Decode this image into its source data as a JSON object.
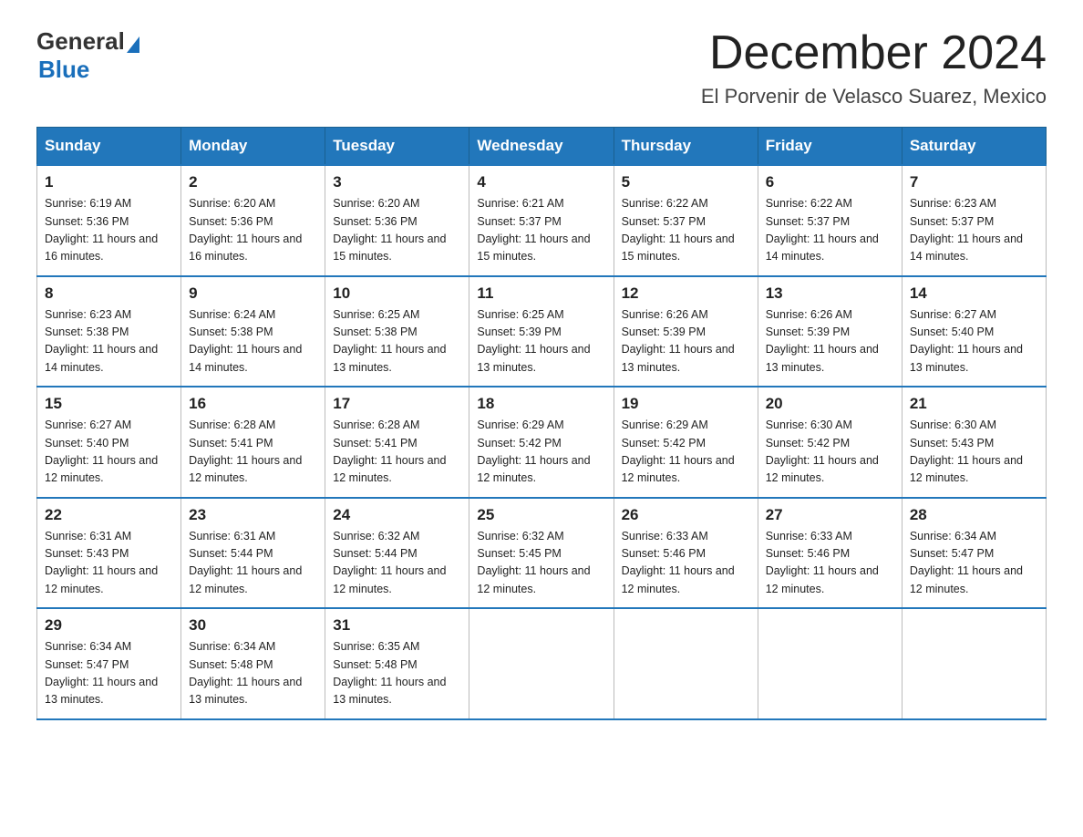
{
  "logo": {
    "general": "General",
    "blue": "Blue"
  },
  "header": {
    "title": "December 2024",
    "subtitle": "El Porvenir de Velasco Suarez, Mexico"
  },
  "days_of_week": [
    "Sunday",
    "Monday",
    "Tuesday",
    "Wednesday",
    "Thursday",
    "Friday",
    "Saturday"
  ],
  "weeks": [
    [
      {
        "day": "1",
        "sunrise": "Sunrise: 6:19 AM",
        "sunset": "Sunset: 5:36 PM",
        "daylight": "Daylight: 11 hours and 16 minutes."
      },
      {
        "day": "2",
        "sunrise": "Sunrise: 6:20 AM",
        "sunset": "Sunset: 5:36 PM",
        "daylight": "Daylight: 11 hours and 16 minutes."
      },
      {
        "day": "3",
        "sunrise": "Sunrise: 6:20 AM",
        "sunset": "Sunset: 5:36 PM",
        "daylight": "Daylight: 11 hours and 15 minutes."
      },
      {
        "day": "4",
        "sunrise": "Sunrise: 6:21 AM",
        "sunset": "Sunset: 5:37 PM",
        "daylight": "Daylight: 11 hours and 15 minutes."
      },
      {
        "day": "5",
        "sunrise": "Sunrise: 6:22 AM",
        "sunset": "Sunset: 5:37 PM",
        "daylight": "Daylight: 11 hours and 15 minutes."
      },
      {
        "day": "6",
        "sunrise": "Sunrise: 6:22 AM",
        "sunset": "Sunset: 5:37 PM",
        "daylight": "Daylight: 11 hours and 14 minutes."
      },
      {
        "day": "7",
        "sunrise": "Sunrise: 6:23 AM",
        "sunset": "Sunset: 5:37 PM",
        "daylight": "Daylight: 11 hours and 14 minutes."
      }
    ],
    [
      {
        "day": "8",
        "sunrise": "Sunrise: 6:23 AM",
        "sunset": "Sunset: 5:38 PM",
        "daylight": "Daylight: 11 hours and 14 minutes."
      },
      {
        "day": "9",
        "sunrise": "Sunrise: 6:24 AM",
        "sunset": "Sunset: 5:38 PM",
        "daylight": "Daylight: 11 hours and 14 minutes."
      },
      {
        "day": "10",
        "sunrise": "Sunrise: 6:25 AM",
        "sunset": "Sunset: 5:38 PM",
        "daylight": "Daylight: 11 hours and 13 minutes."
      },
      {
        "day": "11",
        "sunrise": "Sunrise: 6:25 AM",
        "sunset": "Sunset: 5:39 PM",
        "daylight": "Daylight: 11 hours and 13 minutes."
      },
      {
        "day": "12",
        "sunrise": "Sunrise: 6:26 AM",
        "sunset": "Sunset: 5:39 PM",
        "daylight": "Daylight: 11 hours and 13 minutes."
      },
      {
        "day": "13",
        "sunrise": "Sunrise: 6:26 AM",
        "sunset": "Sunset: 5:39 PM",
        "daylight": "Daylight: 11 hours and 13 minutes."
      },
      {
        "day": "14",
        "sunrise": "Sunrise: 6:27 AM",
        "sunset": "Sunset: 5:40 PM",
        "daylight": "Daylight: 11 hours and 13 minutes."
      }
    ],
    [
      {
        "day": "15",
        "sunrise": "Sunrise: 6:27 AM",
        "sunset": "Sunset: 5:40 PM",
        "daylight": "Daylight: 11 hours and 12 minutes."
      },
      {
        "day": "16",
        "sunrise": "Sunrise: 6:28 AM",
        "sunset": "Sunset: 5:41 PM",
        "daylight": "Daylight: 11 hours and 12 minutes."
      },
      {
        "day": "17",
        "sunrise": "Sunrise: 6:28 AM",
        "sunset": "Sunset: 5:41 PM",
        "daylight": "Daylight: 11 hours and 12 minutes."
      },
      {
        "day": "18",
        "sunrise": "Sunrise: 6:29 AM",
        "sunset": "Sunset: 5:42 PM",
        "daylight": "Daylight: 11 hours and 12 minutes."
      },
      {
        "day": "19",
        "sunrise": "Sunrise: 6:29 AM",
        "sunset": "Sunset: 5:42 PM",
        "daylight": "Daylight: 11 hours and 12 minutes."
      },
      {
        "day": "20",
        "sunrise": "Sunrise: 6:30 AM",
        "sunset": "Sunset: 5:42 PM",
        "daylight": "Daylight: 11 hours and 12 minutes."
      },
      {
        "day": "21",
        "sunrise": "Sunrise: 6:30 AM",
        "sunset": "Sunset: 5:43 PM",
        "daylight": "Daylight: 11 hours and 12 minutes."
      }
    ],
    [
      {
        "day": "22",
        "sunrise": "Sunrise: 6:31 AM",
        "sunset": "Sunset: 5:43 PM",
        "daylight": "Daylight: 11 hours and 12 minutes."
      },
      {
        "day": "23",
        "sunrise": "Sunrise: 6:31 AM",
        "sunset": "Sunset: 5:44 PM",
        "daylight": "Daylight: 11 hours and 12 minutes."
      },
      {
        "day": "24",
        "sunrise": "Sunrise: 6:32 AM",
        "sunset": "Sunset: 5:44 PM",
        "daylight": "Daylight: 11 hours and 12 minutes."
      },
      {
        "day": "25",
        "sunrise": "Sunrise: 6:32 AM",
        "sunset": "Sunset: 5:45 PM",
        "daylight": "Daylight: 11 hours and 12 minutes."
      },
      {
        "day": "26",
        "sunrise": "Sunrise: 6:33 AM",
        "sunset": "Sunset: 5:46 PM",
        "daylight": "Daylight: 11 hours and 12 minutes."
      },
      {
        "day": "27",
        "sunrise": "Sunrise: 6:33 AM",
        "sunset": "Sunset: 5:46 PM",
        "daylight": "Daylight: 11 hours and 12 minutes."
      },
      {
        "day": "28",
        "sunrise": "Sunrise: 6:34 AM",
        "sunset": "Sunset: 5:47 PM",
        "daylight": "Daylight: 11 hours and 12 minutes."
      }
    ],
    [
      {
        "day": "29",
        "sunrise": "Sunrise: 6:34 AM",
        "sunset": "Sunset: 5:47 PM",
        "daylight": "Daylight: 11 hours and 13 minutes."
      },
      {
        "day": "30",
        "sunrise": "Sunrise: 6:34 AM",
        "sunset": "Sunset: 5:48 PM",
        "daylight": "Daylight: 11 hours and 13 minutes."
      },
      {
        "day": "31",
        "sunrise": "Sunrise: 6:35 AM",
        "sunset": "Sunset: 5:48 PM",
        "daylight": "Daylight: 11 hours and 13 minutes."
      },
      null,
      null,
      null,
      null
    ]
  ]
}
